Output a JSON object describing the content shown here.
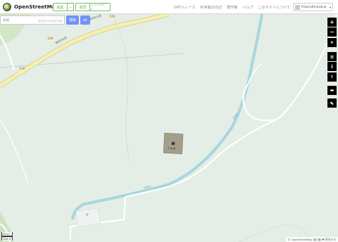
{
  "header": {
    "logo_text": "OpenStreetMap",
    "edit_label": "編集",
    "edit_caret": "▾",
    "history_label": "履歴",
    "export_label": "エクスポート",
    "nav": [
      "GPSトレース",
      "利用者の日記",
      "著作権",
      "ヘルプ",
      "このサイトについて"
    ],
    "user_name": "HikaruKinkakuji",
    "user_caret": "▾"
  },
  "search": {
    "placeholder": "検索",
    "hint": "現在表示中の位置を検索",
    "go_label": "検索",
    "directions_icon": "directions-arrow"
  },
  "controls": [
    {
      "name": "zoom-in",
      "symbol": "+"
    },
    {
      "name": "zoom-out",
      "symbol": "−"
    },
    {
      "name": "show-my-location",
      "symbol": "➤"
    },
    {
      "name": "layers",
      "symbol": "≡"
    },
    {
      "name": "map-info",
      "symbol": "i"
    },
    {
      "name": "share",
      "symbol": "⇪"
    },
    {
      "name": "add-note",
      "symbol": "▬"
    },
    {
      "name": "query-features",
      "symbol": "⬉"
    }
  ],
  "map_labels": {
    "road_126_a": "126",
    "road_126_b": "126",
    "road_126_c": "126",
    "road_name_a": "鹿苑寺北線",
    "road_name_b": "鹿苑寺北線",
    "stream_label": "紙屋川",
    "stream_label_b": "紙屋川",
    "building_label": "不 動 堂",
    "parking": "P"
  },
  "scale": {
    "metric": "30 m",
    "imperial": "100 ft"
  },
  "attribution": "© OpenStreetMap 協力者 ♥ 寄付する"
}
